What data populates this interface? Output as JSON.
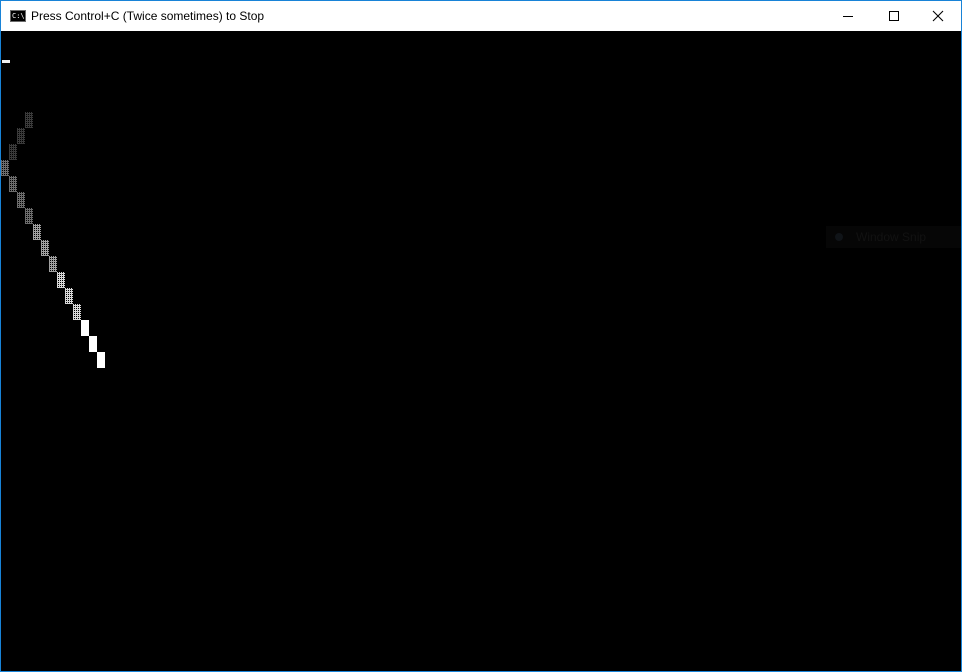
{
  "window": {
    "title": "Press Control+C (Twice sometimes) to Stop",
    "icon": "console-icon",
    "icon_glyph": "C:\\",
    "buttons": {
      "minimize": "minimize-icon",
      "maximize": "maximize-icon",
      "close": "close-icon"
    }
  },
  "snap_assist": {
    "label": "Window Snip"
  },
  "colors": {
    "console_background": "#000000",
    "titlebar_background": "#ffffff",
    "window_border": "#1883d7",
    "trail_shades": [
      "#3a3a3a",
      "#6c6c6c",
      "#a0a0a0",
      "#d8d8d8",
      "#ffffff"
    ]
  }
}
